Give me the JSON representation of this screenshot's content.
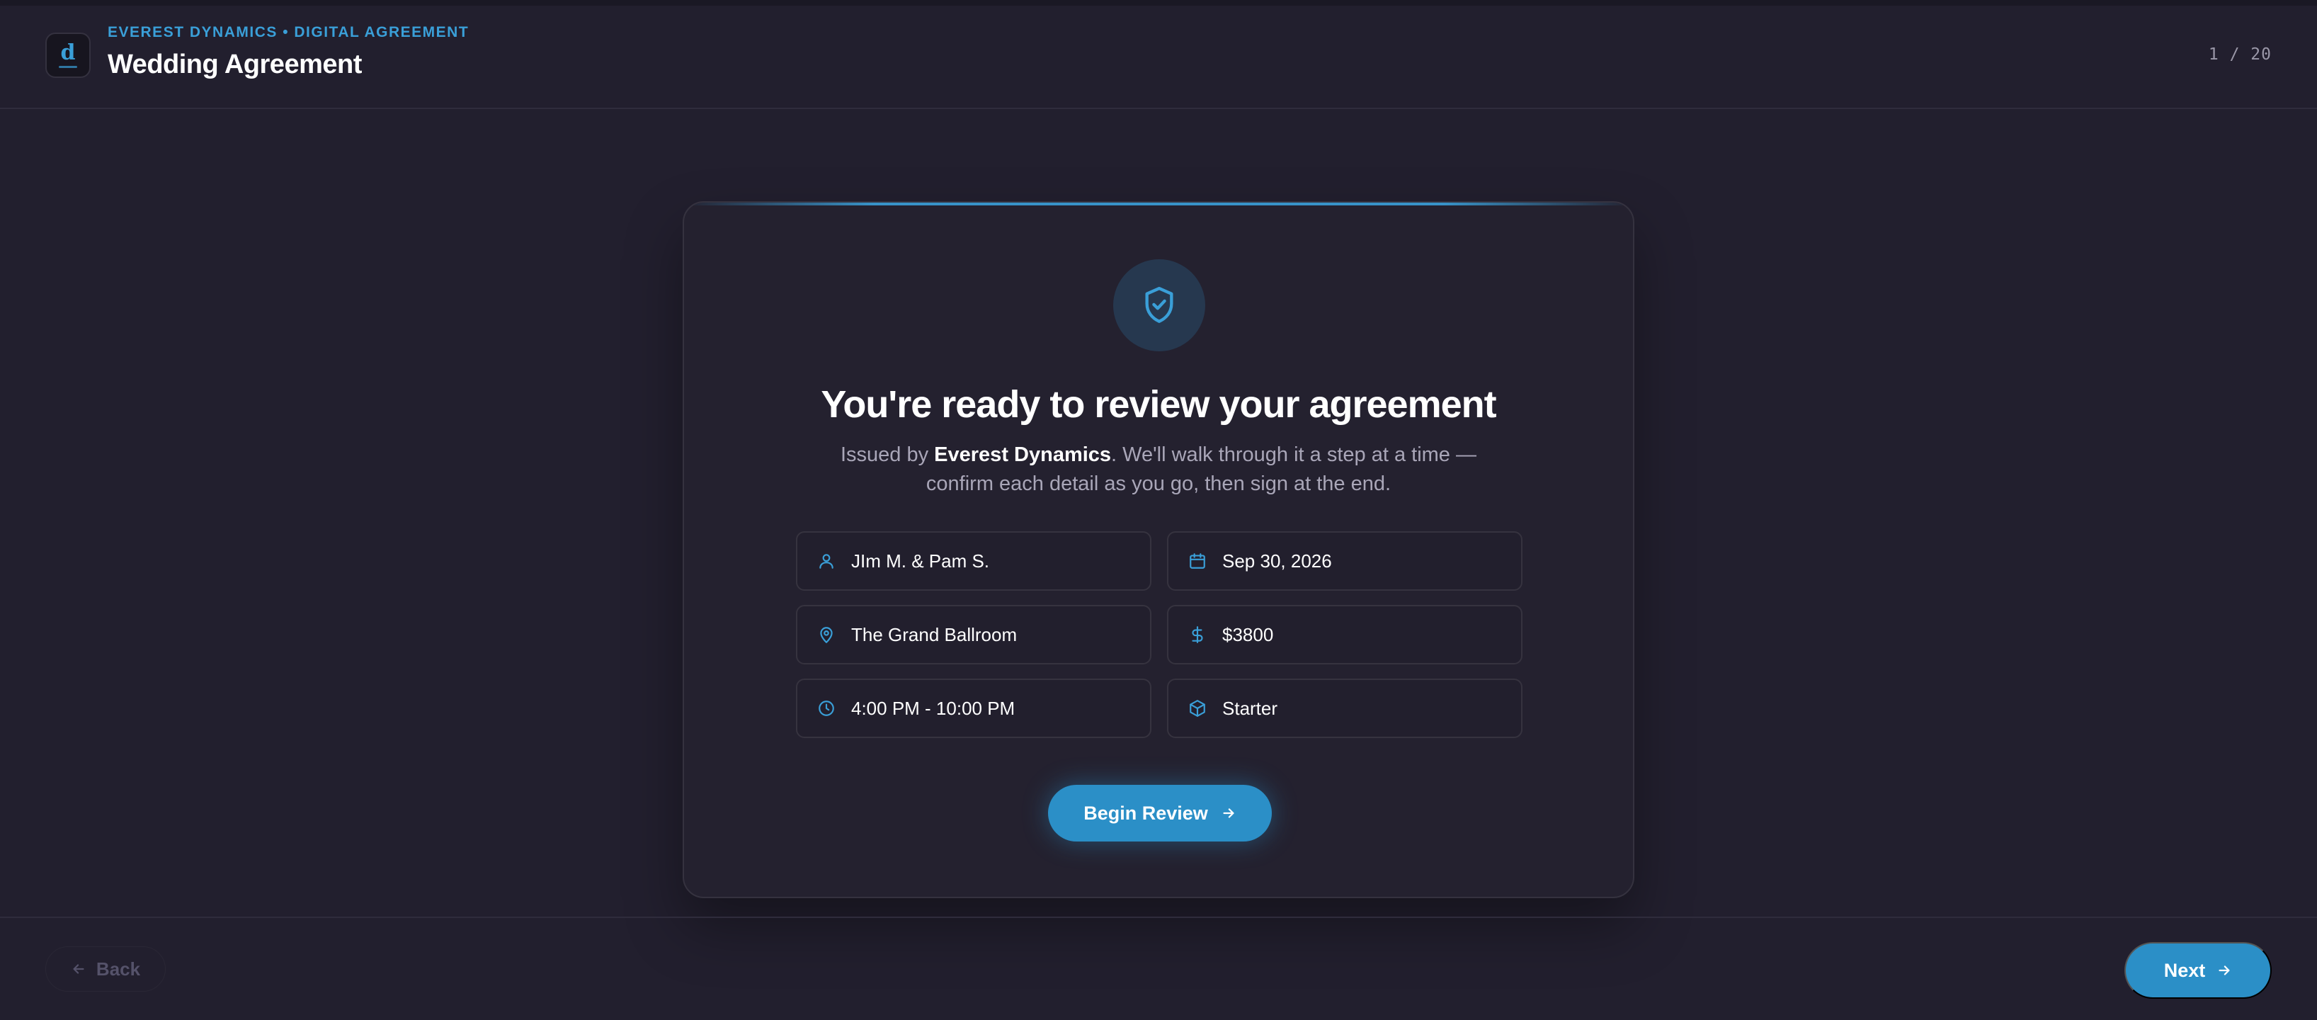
{
  "header": {
    "eyebrow": "EVEREST DYNAMICS • DIGITAL AGREEMENT",
    "title": "Wedding Agreement",
    "step_counter": "1 / 20"
  },
  "card": {
    "heading": "You're ready to review your agreement",
    "subtitle_prefix": "Issued by ",
    "issuer": "Everest Dynamics",
    "subtitle_suffix": ". We'll walk through it a step at a time — confirm each detail as you go, then sign at the end.",
    "fields": [
      {
        "icon": "user-icon",
        "value": "JIm M. & Pam S."
      },
      {
        "icon": "calendar-icon",
        "value": "Sep 30, 2026"
      },
      {
        "icon": "map-pin-icon",
        "value": "The Grand Ballroom"
      },
      {
        "icon": "dollar-icon",
        "value": "$3800"
      },
      {
        "icon": "clock-icon",
        "value": "4:00 PM - 10:00 PM"
      },
      {
        "icon": "package-icon",
        "value": "Starter"
      }
    ],
    "begin_label": "Begin Review"
  },
  "footer": {
    "back_label": "Back",
    "next_label": "Next"
  },
  "colors": {
    "background": "#221f2e",
    "accent": "#2b8fc7",
    "accent_text": "#3a9fd8"
  }
}
